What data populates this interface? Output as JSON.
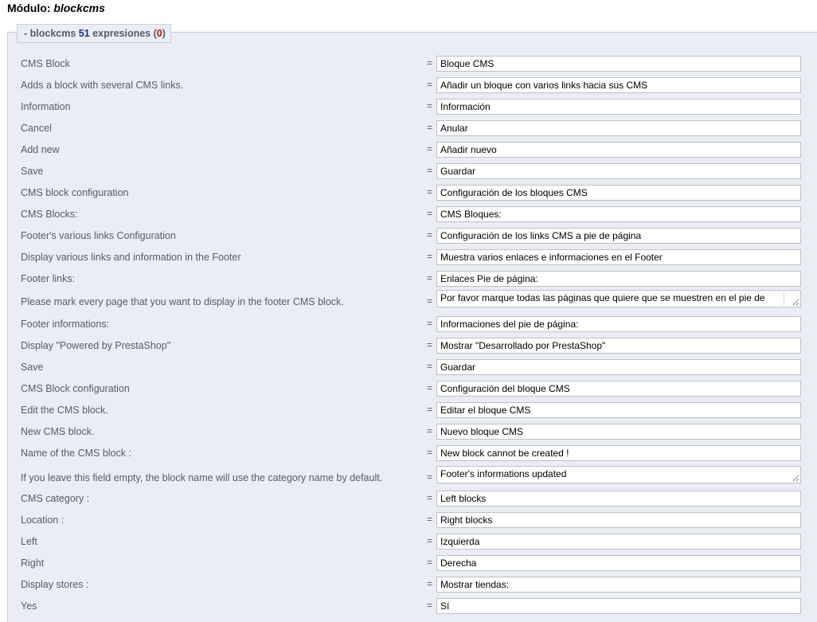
{
  "header": {
    "prefix": "Módulo: ",
    "module_name": "blockcms"
  },
  "legend": {
    "prefix": "- blockcms ",
    "count": "51",
    "middle": " expresiones (",
    "errors": "0",
    "suffix": ")"
  },
  "rows": [
    {
      "label": "CMS Block",
      "value": "Bloque CMS"
    },
    {
      "label": "Adds a block with several CMS links.",
      "value": "Añadir un bloque con varios links hacia sus CMS"
    },
    {
      "label": "Information",
      "value": "Información"
    },
    {
      "label": "Cancel",
      "value": "Anular"
    },
    {
      "label": "Add new",
      "value": "Añadir nuevo"
    },
    {
      "label": "Save",
      "value": "Guardar"
    },
    {
      "label": "CMS block configuration",
      "value": "Configuración de los bloques CMS"
    },
    {
      "label": "CMS Blocks:",
      "value": "CMS Bloques:"
    },
    {
      "label": "Footer's various links Configuration",
      "value": "Configuración de los links CMS a pie de página"
    },
    {
      "label": "Display various links and information in the Footer",
      "value": "Muestra varios enlaces e informaciones en el Footer"
    },
    {
      "label": "Footer links:",
      "value": "Enlaces Pie de página:"
    },
    {
      "label": "Please mark every page that you want to display in the footer CMS block.",
      "value": "Por favor marque todas las páginas que quiere que se muestren en el pie de"
    },
    {
      "label": "Footer informations:",
      "value": "Informaciones del pie de página:"
    },
    {
      "label": "Display \"Powered by PrestaShop\"",
      "value": "Mostrar \"Desarrollado por PrestaShop\""
    },
    {
      "label": "Save",
      "value": "Guardar"
    },
    {
      "label": "CMS Block configuration",
      "value": "Configuración del bloque CMS"
    },
    {
      "label": "Edit the CMS block.",
      "value": "Editar el bloque CMS"
    },
    {
      "label": "New CMS block.",
      "value": "Nuevo bloque CMS"
    },
    {
      "label": "Name of the CMS block :",
      "value": "New block cannot be created !"
    },
    {
      "label": "If you leave this field empty, the block name will use the category name by default.",
      "value": "Footer's informations updated"
    },
    {
      "label": "CMS category :",
      "value": "Left blocks"
    },
    {
      "label": "Location :",
      "value": "Right blocks"
    },
    {
      "label": "Left",
      "value": "Izquierda"
    },
    {
      "label": "Right",
      "value": "Derecha"
    },
    {
      "label": "Display stores :",
      "value": "Mostrar tiendas:"
    },
    {
      "label": "Yes",
      "value": "Sí"
    }
  ],
  "equals_sign": "="
}
